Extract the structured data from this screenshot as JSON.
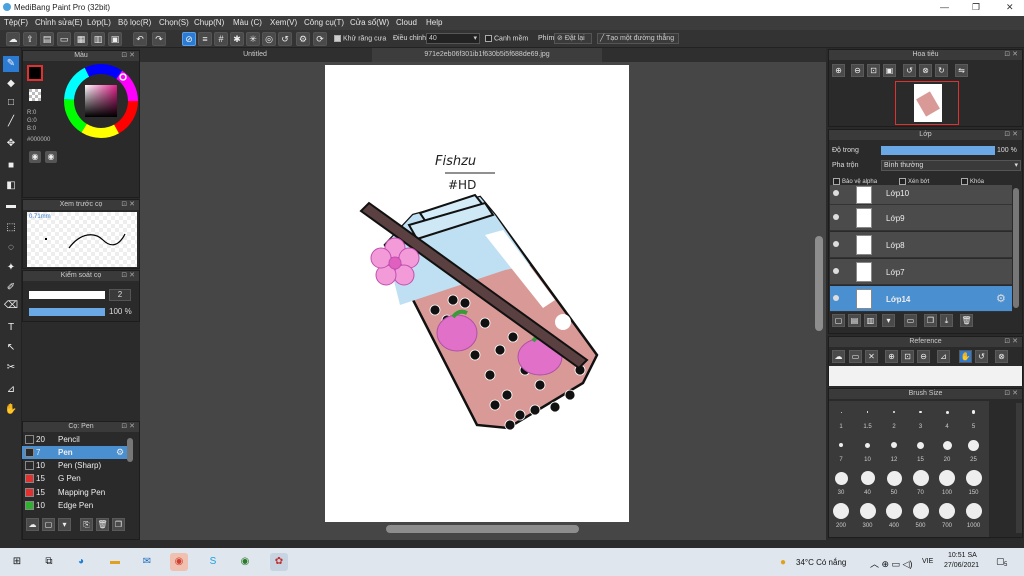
{
  "window": {
    "title": "MediBang Paint Pro (32bit)"
  },
  "menu": [
    "Tệp(F)",
    "Chỉnh sửa(E)",
    "Lớp(L)",
    "Bộ lọc(R)",
    "Chọn(S)",
    "Chụp(N)",
    "Màu (C)",
    "Xem(V)",
    "Công cụ(T)",
    "Cửa sổ(W)",
    "Cloud",
    "Help"
  ],
  "toolbar": {
    "antialias_label": "Khử răng cưa",
    "adjust_label": "Điều chỉnh",
    "adjust_value": "40",
    "smooth_label": "Canh mềm",
    "pen_label": "Phím",
    "reset_label": "Đặt lại",
    "ruler_label": "Tạo một đường thẳng"
  },
  "tabs": [
    "Untitled",
    "971e2eb06f301ib1f630b5i5f688de69.jpg"
  ],
  "color_panel": {
    "title": "Màu",
    "r": "R:0",
    "g": "G:0",
    "b": "B:0",
    "hex": "#000000"
  },
  "preview_panel": {
    "title": "Xem trước cọ",
    "size": "0.71mm"
  },
  "brush_control": {
    "title": "Kiểm soát cọ",
    "size": "2",
    "opacity": "100 %"
  },
  "brush_list": {
    "title": "Cọ: Pen",
    "items": [
      {
        "size": "20",
        "name": "Pencil",
        "color": "#2a2a2a"
      },
      {
        "size": "7",
        "name": "Pen",
        "color": "#2a2a2a"
      },
      {
        "size": "10",
        "name": "Pen (Sharp)",
        "color": "#2a2a2a"
      },
      {
        "size": "15",
        "name": "G Pen",
        "color": "#e03030"
      },
      {
        "size": "15",
        "name": "Mapping Pen",
        "color": "#e03030"
      },
      {
        "size": "10",
        "name": "Edge Pen",
        "color": "#30b030"
      }
    ]
  },
  "navigator": {
    "title": "Hoa tiêu"
  },
  "layer_panel": {
    "title": "Lớp",
    "opacity_label": "Độ trong",
    "opacity_value": "100 %",
    "blend_label": "Pha trộn",
    "blend_value": "Bình thường",
    "protect_alpha": "Bảo vệ alpha",
    "clipping": "Xén bớt",
    "lock": "Khóa",
    "layers": [
      "Lớp10",
      "Lớp9",
      "Lớp8",
      "Lớp7",
      "Lớp14"
    ]
  },
  "reference_panel": {
    "title": "Reference"
  },
  "brush_size_panel": {
    "title": "Brush Size",
    "rows": [
      [
        "1",
        "1.5",
        "2",
        "3",
        "4",
        "5"
      ],
      [
        "7",
        "10",
        "12",
        "15",
        "20",
        "25"
      ],
      [
        "30",
        "40",
        "50",
        "70",
        "100",
        "150"
      ],
      [
        "200",
        "300",
        "400",
        "500",
        "700",
        "1000"
      ]
    ]
  },
  "artwork": {
    "title_line1": "Fishzu",
    "title_line2": "#HD"
  },
  "taskbar": {
    "weather": "34°C Có nắng",
    "lang": "VIE",
    "time": "10:51 SA",
    "date": "27/06/2021",
    "notif": "5"
  }
}
